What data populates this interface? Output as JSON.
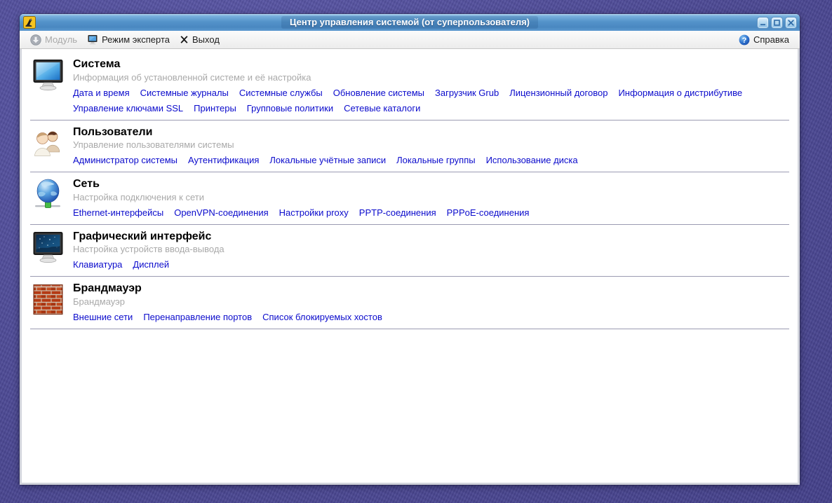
{
  "window": {
    "title": "Центр управления системой (от суперпользователя)",
    "app_icon": "alt-control-center-icon",
    "controls": {
      "minimize": "minimize",
      "maximize": "maximize",
      "close": "close"
    }
  },
  "toolbar": {
    "module": "Модуль",
    "expert_mode": "Режим эксперта",
    "exit": "Выход",
    "help": "Справка"
  },
  "sections": [
    {
      "title": "Система",
      "subtitle": "Информация об установленной системе и её настройка",
      "icon": "system-monitor-icon",
      "links": [
        "Дата и время",
        "Системные журналы",
        "Системные службы",
        "Обновление системы",
        "Загрузчик Grub",
        "Лицензионный договор",
        "Информация о дистрибутиве",
        "Управление ключами SSL",
        "Принтеры",
        "Групповые политики",
        "Сетевые каталоги"
      ]
    },
    {
      "title": "Пользователи",
      "subtitle": "Управление пользователями системы",
      "icon": "users-icon",
      "links": [
        "Администратор системы",
        "Аутентификация",
        "Локальные учётные записи",
        "Локальные группы",
        "Использование диска"
      ]
    },
    {
      "title": "Сеть",
      "subtitle": "Настройка подключения к сети",
      "icon": "network-globe-icon",
      "links": [
        "Ethernet-интерфейсы",
        "OpenVPN-соединения",
        "Настройки proxy",
        "PPTP-соединения",
        "PPPoE-соединения"
      ]
    },
    {
      "title": "Графический интерфейс",
      "subtitle": "Настройка устройств ввода-вывода",
      "icon": "display-icon",
      "links": [
        "Клавиатура",
        "Дисплей"
      ]
    },
    {
      "title": "Брандмауэр",
      "subtitle": "Брандмауэр",
      "icon": "firewall-icon",
      "links": [
        "Внешние сети",
        "Перенаправление портов",
        "Список блокируемых хостов"
      ]
    }
  ],
  "colors": {
    "link": "#0b0bcc",
    "titlebar_blue": "#4d8cc6",
    "subtitle_gray": "#a9a9a9",
    "desktop_purple": "#514e98"
  }
}
